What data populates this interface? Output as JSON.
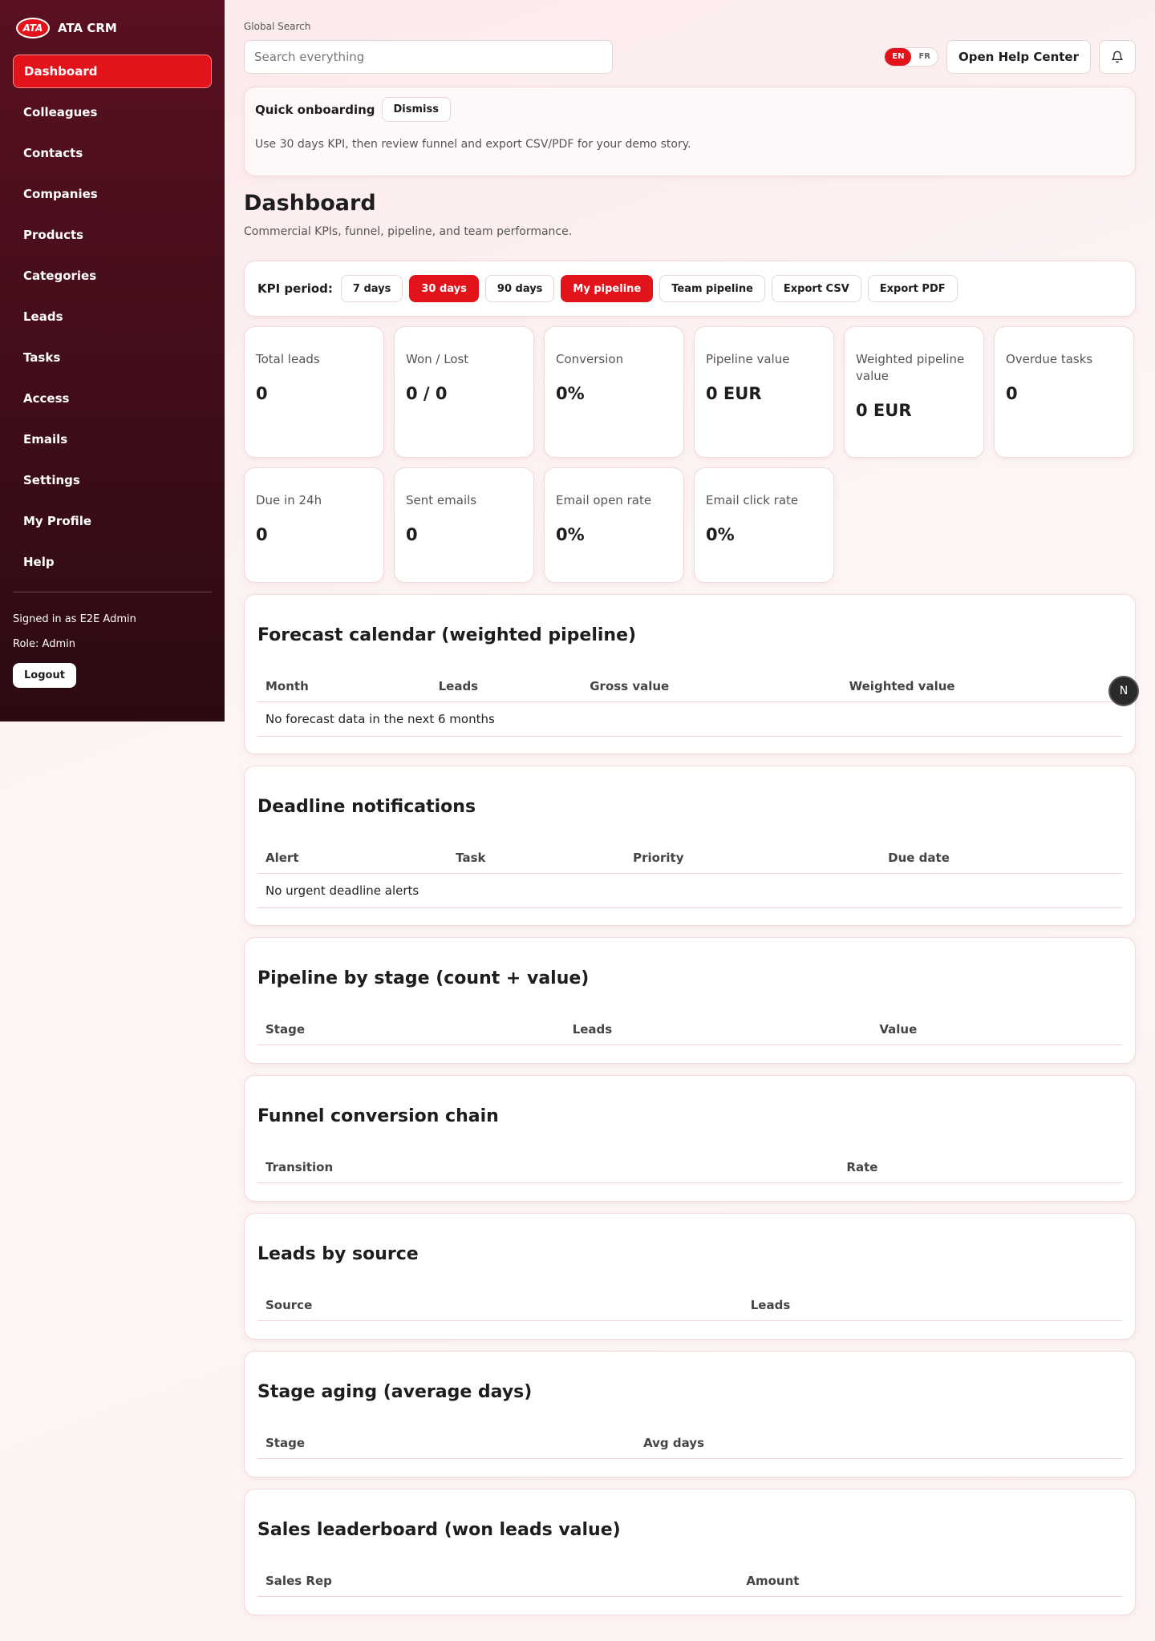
{
  "brand": {
    "logo": "ATA",
    "name": "ATA CRM"
  },
  "sidebar": {
    "items": [
      {
        "label": "Dashboard",
        "active": true
      },
      {
        "label": "Colleagues"
      },
      {
        "label": "Contacts"
      },
      {
        "label": "Companies"
      },
      {
        "label": "Products"
      },
      {
        "label": "Categories"
      },
      {
        "label": "Leads"
      },
      {
        "label": "Tasks"
      },
      {
        "label": "Access"
      },
      {
        "label": "Emails"
      },
      {
        "label": "Settings"
      },
      {
        "label": "My Profile"
      },
      {
        "label": "Help"
      }
    ],
    "signed_in": "Signed in as E2E Admin",
    "role": "Role: Admin",
    "logout": "Logout"
  },
  "search": {
    "label": "Global Search",
    "placeholder": "Search everything"
  },
  "lang": {
    "en": "EN",
    "fr": "FR",
    "active": "EN"
  },
  "header": {
    "help_label": "Open Help Center",
    "bell_icon": "bell-icon"
  },
  "onboarding": {
    "title": "Quick onboarding",
    "dismiss": "Dismiss",
    "text": "Use 30 days KPI, then review funnel and export CSV/PDF for your demo story."
  },
  "page": {
    "title": "Dashboard",
    "subtitle": "Commercial KPIs, funnel, pipeline, and team performance."
  },
  "kpi_period": {
    "label": "KPI period:",
    "buttons": [
      {
        "label": "7 days",
        "active": false
      },
      {
        "label": "30 days",
        "active": true
      },
      {
        "label": "90 days",
        "active": false
      },
      {
        "label": "My pipeline",
        "active": true
      },
      {
        "label": "Team pipeline",
        "active": false
      },
      {
        "label": "Export CSV",
        "active": false
      },
      {
        "label": "Export PDF",
        "active": false
      }
    ]
  },
  "kpis": [
    {
      "name": "Total leads",
      "value": "0"
    },
    {
      "name": "Won / Lost",
      "value": "0 / 0"
    },
    {
      "name": "Conversion",
      "value": "0%"
    },
    {
      "name": "Pipeline value",
      "value": "0 EUR"
    },
    {
      "name": "Weighted pipeline value",
      "value": "0 EUR"
    },
    {
      "name": "Overdue tasks",
      "value": "0"
    },
    {
      "name": "Due in 24h",
      "value": "0"
    },
    {
      "name": "Sent emails",
      "value": "0"
    },
    {
      "name": "Email open rate",
      "value": "0%"
    },
    {
      "name": "Email click rate",
      "value": "0%"
    }
  ],
  "sections": {
    "forecast": {
      "title": "Forecast calendar (weighted pipeline)",
      "columns": [
        "Month",
        "Leads",
        "Gross value",
        "Weighted value"
      ],
      "empty": "No forecast data in the next 6 months"
    },
    "deadlines": {
      "title": "Deadline notifications",
      "columns": [
        "Alert",
        "Task",
        "Priority",
        "Due date"
      ],
      "empty": "No urgent deadline alerts"
    },
    "pipeline": {
      "title": "Pipeline by stage (count + value)",
      "columns": [
        "Stage",
        "Leads",
        "Value"
      ]
    },
    "funnel": {
      "title": "Funnel conversion chain",
      "columns": [
        "Transition",
        "Rate"
      ]
    },
    "sources": {
      "title": "Leads by source",
      "columns": [
        "Source",
        "Leads"
      ]
    },
    "aging": {
      "title": "Stage aging (average days)",
      "columns": [
        "Stage",
        "Avg days"
      ]
    },
    "leaderboard": {
      "title": "Sales leaderboard (won leads value)",
      "columns": [
        "Sales Rep",
        "Amount"
      ]
    }
  },
  "floating_badge": "N",
  "colors": {
    "accent": "#e3131b",
    "sidebar": "#4a0f1b"
  }
}
